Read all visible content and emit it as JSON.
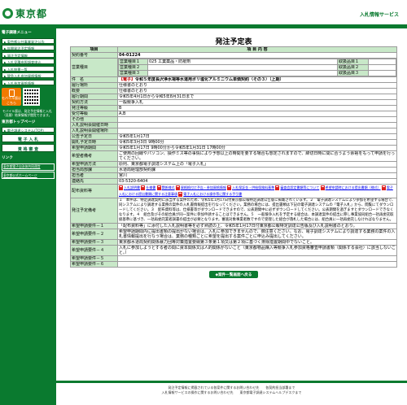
{
  "header": {
    "logo_text": "東京都",
    "service_title": "入札情報サービス"
  },
  "sidebar": {
    "section1": "電子調達メニュー",
    "items": [
      "東京都公共事業発注公告",
      "年間発注予定情報",
      "発注予定情報",
      "入札見積参照調査申込",
      "入札結果一覧",
      "競争入札参加資格情報",
      "入札参加資格情報"
    ],
    "mobile_label": "モバイル版はこちら",
    "mobile_note": "モバイル版は、発注予定情報と入札（見積）結果情報が閲覧できます。",
    "section2": "東京都トップページ",
    "top_btn": "電子調達システム(TOP)",
    "big1": "電 子 入 札",
    "big2": "資 格 審 査",
    "section3": "リンク",
    "links": [
      "東京都電子自治体共同運営",
      "東京都公式ホームページ"
    ]
  },
  "page": {
    "title": "発注予定表",
    "col_item": "項目",
    "col_content": "項 目 内 容",
    "rows": {
      "contract_no_k": "契約番号",
      "contract_no": "04-01224",
      "business_k": "営業種目",
      "biz": [
        {
          "k": "営業種目１",
          "v": "025 工業薬品・防疫剤",
          "pk": "取扱品目１",
          "pv": ""
        },
        {
          "k": "営業種目２",
          "v": "",
          "pk": "取扱品目２",
          "pv": ""
        },
        {
          "k": "営業種目３",
          "v": "",
          "pk": "取扱品目３",
          "pv": ""
        }
      ],
      "subject_k": "件　名",
      "subject_tag": "【電子】",
      "subject": "令和５年度長沢浄水場等水道用ポリ塩化アルミニウム単価契約（その３）（上期）",
      "place_k": "履行場所",
      "place": "仕様書のとおり",
      "summary_k": "概要",
      "summary": "仕様書のとおり",
      "period_k": "履行期間",
      "period": "令和5年4月1日から令和5年8月31日まで",
      "method_k": "契約方法",
      "method": "一般競争入札",
      "section_k": "発注等級",
      "section": "B",
      "grade_k": "受付等級",
      "grade": "A,B",
      "other_k": "その他",
      "other": "",
      "meet_date_k": "入札説明会開催日時",
      "meet_date": "",
      "meet_place_k": "入札説明会開催場所",
      "meet_place": "",
      "pub_date_k": "公告予定日",
      "pub_date": "令和5年1月17日",
      "open_date_k": "開札予定日時",
      "open_date": "令和5年3月3日 9時00分",
      "apply_k": "希望申請期間",
      "apply": "令和5年1月17日 9時00分から令和5年1月31日 17時00分",
      "remarks_k": "希望者備考",
      "remarks": "ご使用の回線やパソコン、操作ミス等の事情により予想以上の時間を要する場合も想定されますので、締切日時に間に合うよう余裕をもって申請を行ってください。",
      "contact_k": "希望申請方法",
      "contact": "原則、東京都電子調達システム上の「電子入札」",
      "dept_k": "担当局部課",
      "dept": "水道局経理部契約課",
      "person_k": "担当者",
      "person": "宮川",
      "tel_k": "連絡先",
      "tel": "03-5320-6404",
      "docs_k": "配布資料等",
      "docs": [
        "入札説明書",
        "仕様書",
        "関係様式",
        "資格格付け予告・参加資格情報",
        "入札保証金・供給保険料基準",
        "審査会設定書類等について",
        "希望申請時における提出書類（様式）",
        "電子入札における提出書類に関する注意事項",
        "電子入札における操作等に関する手引書"
      ],
      "notes_k": "発注予定備考",
      "notes": "１　本件は、特定調達契約に該当する案件のため、令和5年1月17日付東京都公報特定調達公告版に掲載されています。２　電子調達システムにより参加を希望する場合で、同システムにより調達する業務の案件の入札書情報提出を行なってください。業務の場合には、提出書類は下記の電子調達システムの「電子入札」から、閲覧にてダウンロードしてください。３　配布資料等は、仕様書等がダウンロードできますので、公表期間中に必ずダウンロードしてください。公表期間を過ぎますとダウンロードできなくなります。４　組合及びその組合員が同一案件に参加申請することはできません。５　一般競争入札を予定する組合は、本調達案件の提出に際し事業協同組合一括再委託取扱基準に基づき、一括再委託業者調書の提出が必要となります。審査対象事業者数ですので受理した組合が落札した場合には、組合員に一括再委託しなければなりません。",
      "req1_k": "希望申請要件－１",
      "req1": "「配布資料等」に添付した入札説明書等を必ず熟読の上、令和5年1月17日付東京都公報特定調達公告版及び入札説明書のとおり。",
      "req2_k": "希望申請要件－２",
      "req2": "希望申請期間内に提出書類の提出がない場合は、入札に参加できませんので、御注意ください。なお、電子調達システムにより調達する業務の案件の入札書情報提出を行なう場合は、業務の種類ごとに希望を提出する案件ごとに申込み提出してください。",
      "req3_k": "希望申請要件－３",
      "req3": "東京都水道局契約関係暴力団等対策措置要綱第３条第１項又は第２項に基づく排除措置期間中でないこと。",
      "req4_k": "希望申請要件－４",
      "req4": "入札に参加しようとする者の間に資本関係又は人的関係がないこと（東京都物品購入等競争入札参加資格審査申請書類（関係する会社）に該当しないこと。）",
      "req5_k": "希望申請要件－５",
      "req5": "",
      "req6_k": "希望申請要件－６",
      "req6": ""
    },
    "back_button": "◆案件一覧画面へ戻る"
  },
  "footer": {
    "line1": "発注予定情報に掲載されている各案件に関するお問い合わせ先　　各契約担当部署まで",
    "line2": "入札情報サービスの操作に関するお問い合わせ先　　東京都電子調達システムヘルプデスクまで"
  }
}
